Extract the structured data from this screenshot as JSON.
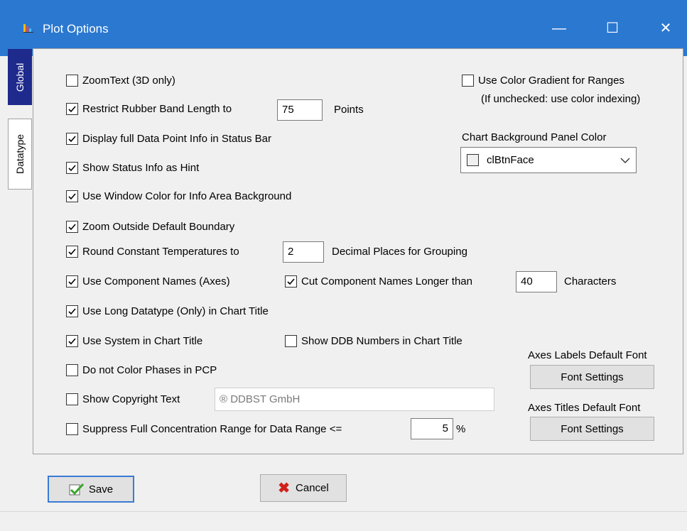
{
  "window": {
    "title": "Plot Options"
  },
  "tabs": [
    "Global",
    "Datatype"
  ],
  "options": {
    "zoom_text": {
      "label": "ZoomText (3D only)",
      "checked": false
    },
    "restrict_rubber_band": {
      "label": "Restrict Rubber Band Length to",
      "checked": true,
      "value": "75",
      "suffix": "Points"
    },
    "display_full_info": {
      "label": "Display full Data Point Info in Status Bar",
      "checked": true
    },
    "status_info_hint": {
      "label": "Show Status Info as Hint",
      "checked": true
    },
    "window_color_info": {
      "label": "Use Window Color for Info Area Background",
      "checked": true
    },
    "zoom_outside": {
      "label": "Zoom Outside Default Boundary",
      "checked": true
    },
    "round_temps": {
      "label": "Round Constant Temperatures to",
      "checked": true,
      "value": "2",
      "suffix": "Decimal Places for Grouping"
    },
    "component_names": {
      "label": "Use Component Names (Axes)",
      "checked": true
    },
    "cut_component_names": {
      "label": "Cut Component Names Longer than",
      "checked": true,
      "value": "40",
      "suffix": "Characters"
    },
    "long_datatype": {
      "label": "Use Long Datatype (Only) in Chart Title",
      "checked": true
    },
    "system_in_title": {
      "label": "Use System in Chart Title",
      "checked": true
    },
    "ddb_numbers": {
      "label": "Show DDB Numbers in Chart Title",
      "checked": false
    },
    "no_color_phases": {
      "label": "Do not Color Phases in PCP",
      "checked": false
    },
    "copyright": {
      "label": "Show Copyright Text",
      "checked": false,
      "placeholder": "® DDBST GmbH"
    },
    "suppress_full_range": {
      "label": "Suppress Full Concentration Range for Data Range <=",
      "checked": false,
      "value": "5",
      "suffix": "%"
    },
    "color_gradient": {
      "label": "Use Color Gradient for Ranges",
      "checked": false,
      "note": "(If unchecked: use color indexing)"
    }
  },
  "background_color": {
    "label": "Chart Background Panel Color",
    "value": "clBtnFace"
  },
  "fonts": {
    "labels_title": "Axes Labels Default Font",
    "labels_button": "Font Settings",
    "titles_title": "Axes Titles Default Font",
    "titles_button": "Font Settings"
  },
  "buttons": {
    "save": "Save",
    "cancel": "Cancel"
  },
  "colors": {
    "titlebar": "#2b78d0",
    "active_tab": "#1e2a8c",
    "cancel_x": "#d0201a",
    "save_check": "#3aa52c"
  }
}
